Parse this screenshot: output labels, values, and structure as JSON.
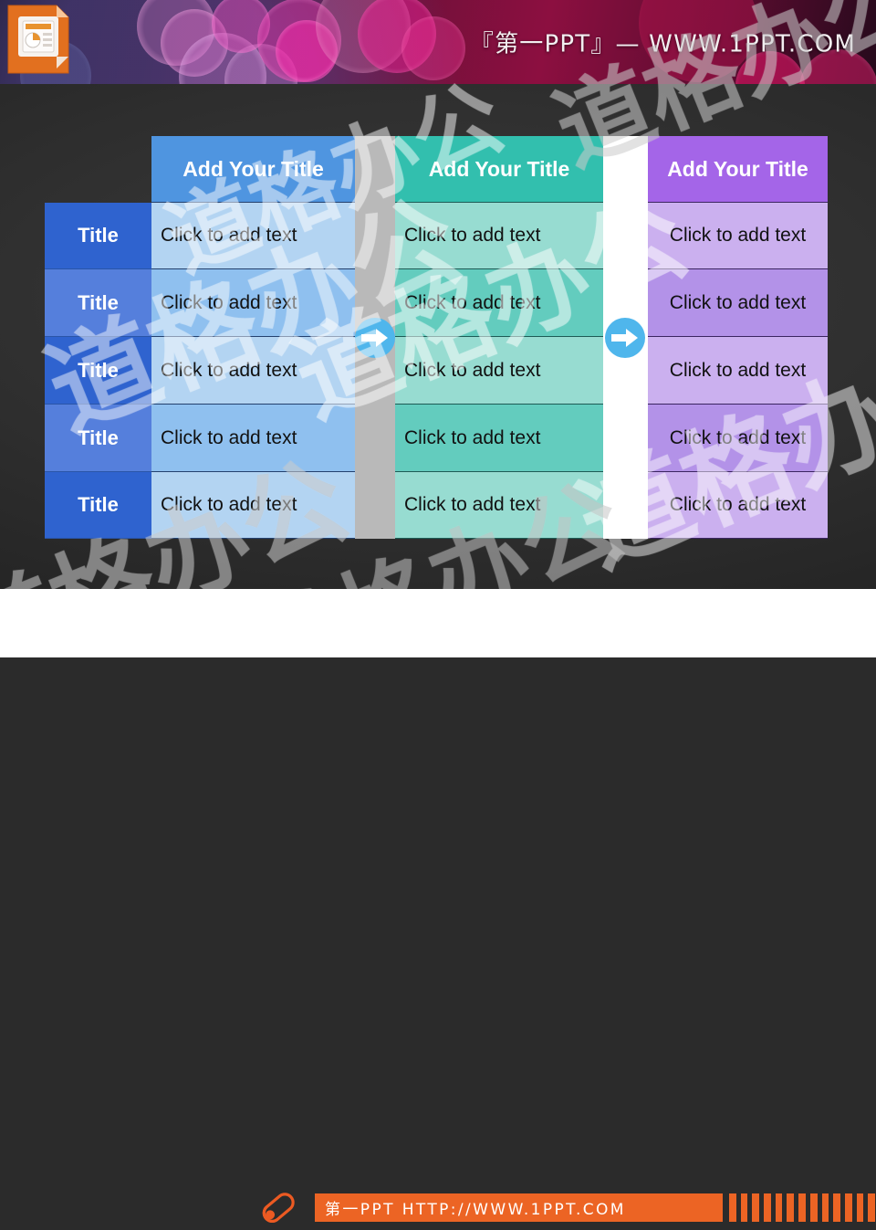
{
  "header": {
    "brand_text": "『第一PPT』— WWW.1PPT.COM",
    "logo_icon": "powerpoint-document-icon"
  },
  "watermark": {
    "text": "道格办公",
    "opacity_note": "semi-transparent repeated diagonal watermark"
  },
  "colors": {
    "blue_header": "#4f95e0",
    "blue_body_light": "#b3d4f2",
    "blue_body_mid": "#8fc0ef",
    "title_dark": "#2f63cf",
    "title_light": "#557fdc",
    "teal_header": "#32bfae",
    "teal_body_light": "#97dcd1",
    "teal_body_mid": "#63ccbe",
    "purple_header": "#a465e8",
    "purple_body_light": "#cbb0ef",
    "purple_body_mid": "#b392e8",
    "separator_gray": "#b9b9b9",
    "separator_white": "#ffffff",
    "arrow_blue": "#4fb6ec",
    "footer_orange": "#ec6424"
  },
  "table": {
    "row_count": 5,
    "title_column": {
      "name": "title-column",
      "cells": [
        "Title",
        "Title",
        "Title",
        "Title",
        "Title"
      ]
    },
    "columns": [
      {
        "key": "blue",
        "name": "blue-column",
        "header": "Add Your Title",
        "cells": [
          "Click to add text",
          "Click to add text",
          "Click to add text",
          "Click to add text",
          "Click to add text"
        ]
      },
      {
        "key": "teal",
        "name": "teal-column",
        "header": "Add Your Title",
        "cells": [
          "Click to add text",
          "Click to add text",
          "Click to add text",
          "Click to add text",
          "Click to add text"
        ]
      },
      {
        "key": "purple",
        "name": "purple-column",
        "header": "Add Your Title",
        "cells": [
          "Click to add text",
          "Click to add text",
          "Click to add text",
          "Click to add text",
          "Click to add text"
        ]
      }
    ],
    "connectors": [
      {
        "name": "arrow-connector-1",
        "icon": "arrow-right-circle-icon"
      },
      {
        "name": "arrow-connector-2",
        "icon": "arrow-right-circle-icon"
      }
    ]
  },
  "footer": {
    "pen_icon": "pen-icon",
    "text": "第一PPT HTTP://WWW.1PPT.COM",
    "tick_count": 13
  }
}
